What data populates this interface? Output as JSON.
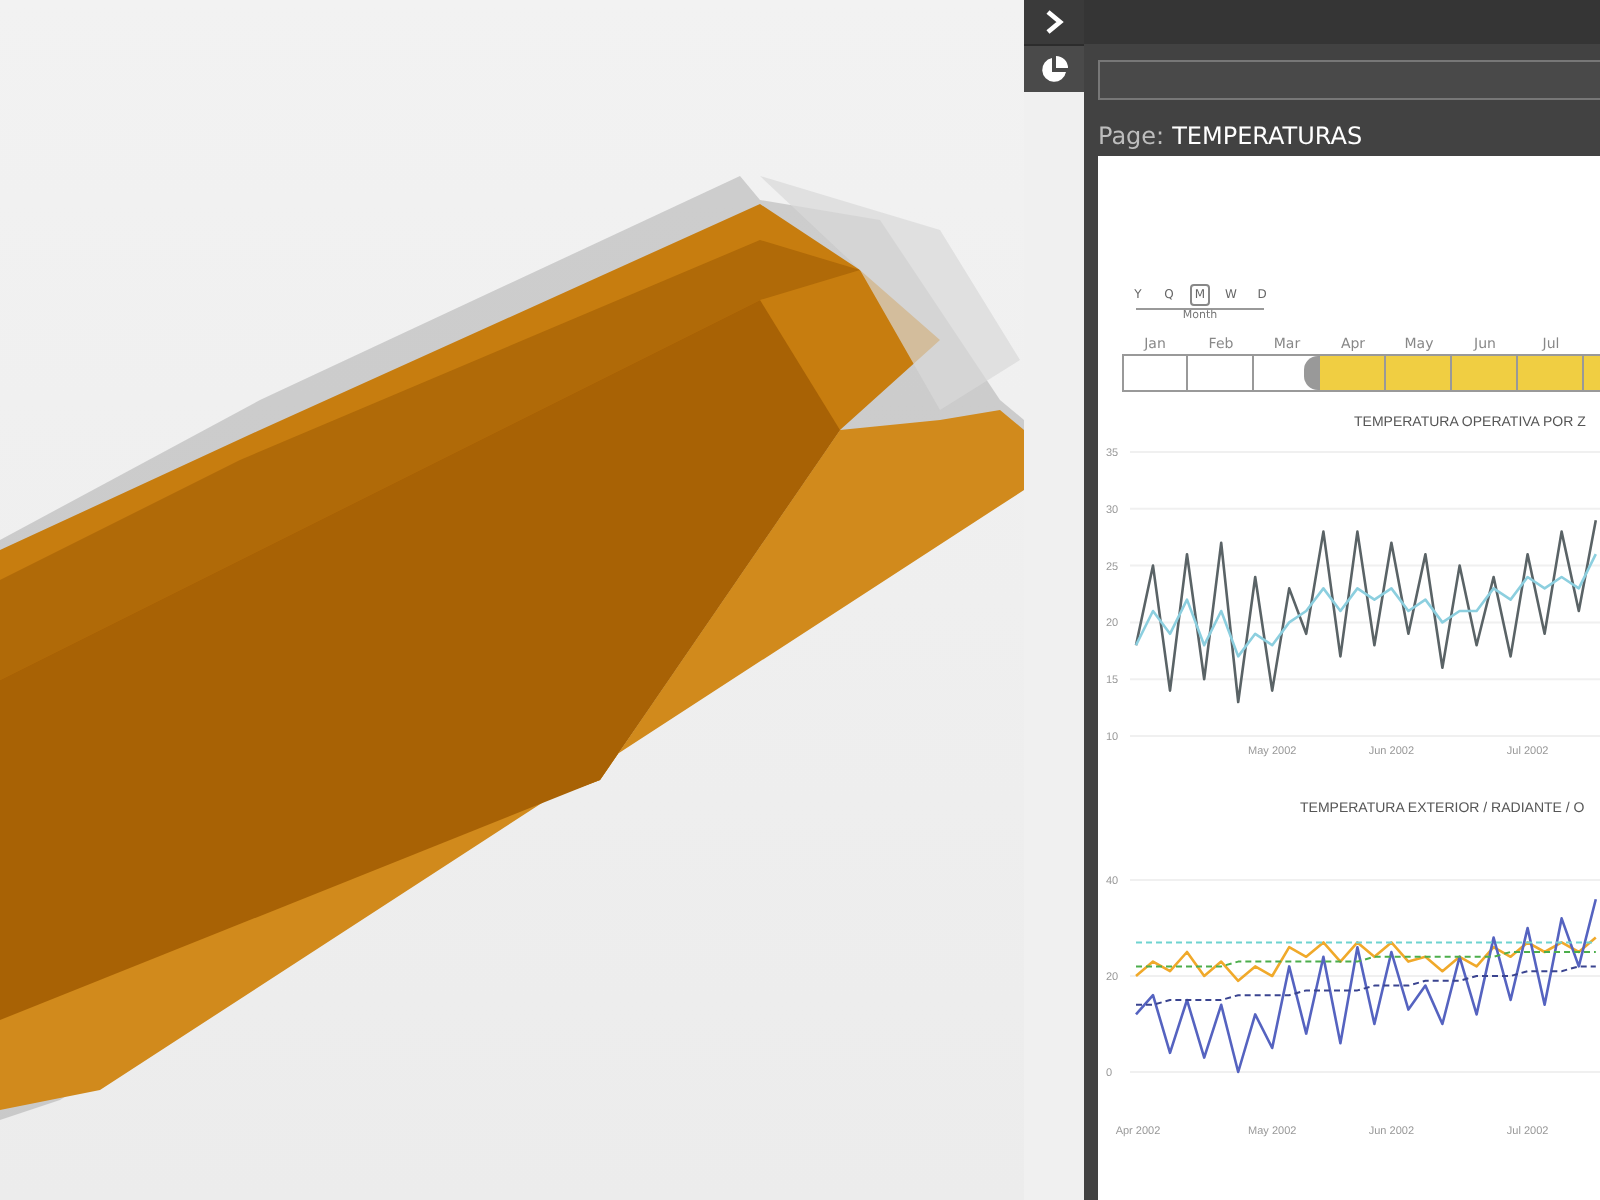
{
  "panel": {
    "page_label": "Page:",
    "page_name": "TEMPERATURAS"
  },
  "timeline": {
    "granularity": [
      {
        "label": "Y",
        "selected": false
      },
      {
        "label": "Q",
        "selected": false
      },
      {
        "label": "M",
        "selected": true
      },
      {
        "label": "W",
        "selected": false
      },
      {
        "label": "D",
        "selected": false
      }
    ],
    "granularity_caption": "Month",
    "months": [
      {
        "label": "Jan",
        "selected": false
      },
      {
        "label": "Feb",
        "selected": false
      },
      {
        "label": "Mar",
        "selected": false
      },
      {
        "label": "Apr",
        "selected": true
      },
      {
        "label": "May",
        "selected": true
      },
      {
        "label": "Jun",
        "selected": true
      },
      {
        "label": "Jul",
        "selected": true
      },
      {
        "selected": true
      }
    ]
  },
  "charts": [
    {
      "chart_data": {
        "type": "line",
        "title": "TEMPERATURA OPERATIVA POR Z",
        "categories": [
          null,
          null,
          null,
          null,
          null,
          null,
          null,
          null,
          "May 2002",
          null,
          null,
          null,
          null,
          null,
          null,
          "Jun 2002",
          null,
          null,
          null,
          null,
          null,
          null,
          null,
          "Jul 2002",
          null,
          null,
          null,
          null
        ],
        "grid": true,
        "series": [
          {
            "color": "#5a6366",
            "line_style": "solid",
            "values": [
              18,
              25,
              14,
              26,
              15,
              27,
              13,
              24,
              14,
              23,
              19,
              28,
              17,
              28,
              18,
              27,
              19,
              26,
              16,
              25,
              18,
              24,
              17,
              26,
              19,
              28,
              21,
              29
            ]
          },
          {
            "color": "#8ccfdf",
            "line_style": "solid",
            "values": [
              18,
              21,
              19,
              22,
              18,
              21,
              17,
              19,
              18,
              20,
              21,
              23,
              21,
              23,
              22,
              23,
              21,
              22,
              20,
              21,
              21,
              23,
              22,
              24,
              23,
              24,
              23,
              26
            ]
          }
        ],
        "ylim": [
          10,
          35
        ],
        "yticks": [
          35,
          30,
          25,
          20,
          15,
          10
        ]
      }
    },
    {
      "chart_data": {
        "type": "line",
        "title": "TEMPERATURA EXTERIOR / RADIANTE / O",
        "categories": [
          "Apr 2002",
          null,
          null,
          null,
          null,
          null,
          null,
          null,
          "May 2002",
          null,
          null,
          null,
          null,
          null,
          null,
          "Jun 2002",
          null,
          null,
          null,
          null,
          null,
          null,
          null,
          "Jul 2002",
          null,
          null,
          null,
          null
        ],
        "grid": true,
        "series": [
          {
            "color": "#f0a92a",
            "line_style": "solid",
            "values": [
              20,
              23,
              21,
              25,
              20,
              23,
              19,
              22,
              20,
              26,
              24,
              27,
              23,
              27,
              24,
              27,
              23,
              24,
              21,
              24,
              22,
              26,
              24,
              27,
              25,
              27,
              25,
              28
            ]
          },
          {
            "color": "#5563c0",
            "line_style": "solid",
            "values": [
              12,
              16,
              4,
              15,
              3,
              14,
              0,
              12,
              5,
              22,
              8,
              24,
              6,
              26,
              10,
              25,
              13,
              18,
              10,
              24,
              12,
              28,
              15,
              30,
              14,
              32,
              22,
              36
            ]
          },
          {
            "color": "#6fd3d0",
            "line_style": "dashed",
            "values": [
              27,
              27,
              27,
              27,
              27,
              27,
              27,
              27,
              27,
              27,
              27,
              27,
              27,
              27,
              27,
              27,
              27,
              27,
              27,
              27,
              27,
              27,
              27,
              27,
              27,
              27,
              27,
              27
            ]
          },
          {
            "color": "#4cae4c",
            "line_style": "dashed",
            "values": [
              22,
              22,
              22,
              22,
              22,
              22,
              23,
              23,
              23,
              23,
              23,
              23,
              23,
              23,
              24,
              24,
              24,
              24,
              24,
              24,
              24,
              24,
              25,
              25,
              25,
              25,
              25,
              25
            ]
          },
          {
            "color": "#3a4490",
            "line_style": "dashed",
            "values": [
              14,
              14,
              15,
              15,
              15,
              15,
              16,
              16,
              16,
              16,
              17,
              17,
              17,
              17,
              18,
              18,
              18,
              19,
              19,
              19,
              20,
              20,
              20,
              21,
              21,
              21,
              22,
              22
            ]
          }
        ],
        "ylim": [
          0,
          40
        ],
        "yticks": [
          40,
          20,
          0
        ]
      }
    }
  ]
}
